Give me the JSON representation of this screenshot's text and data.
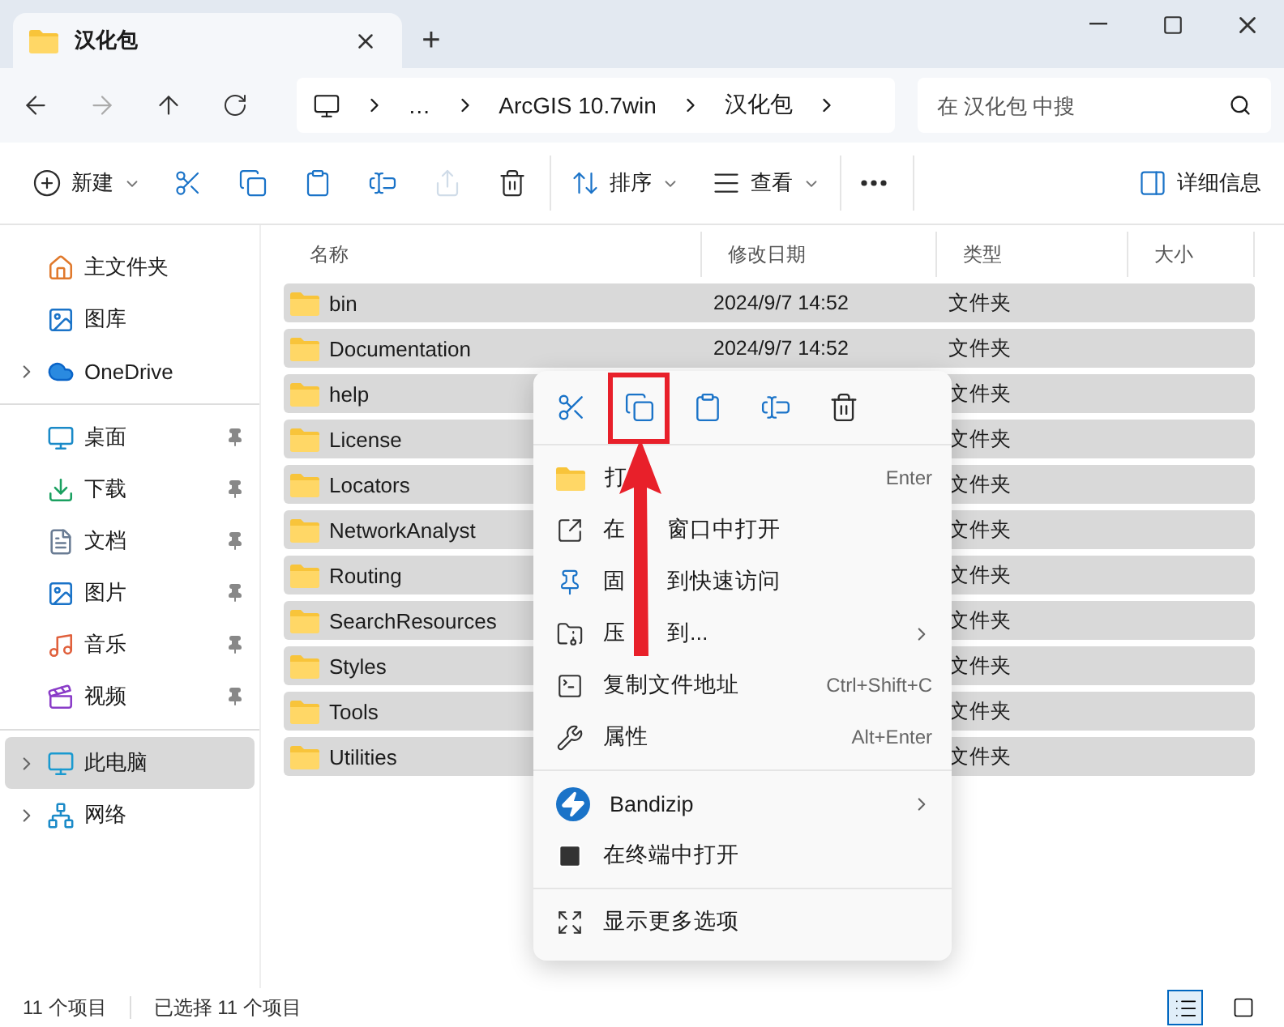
{
  "window": {
    "tab_title": "汉化包",
    "new_tab": "+"
  },
  "navigation": {
    "path": [
      "…",
      "ArcGIS 10.7win",
      "汉化包"
    ],
    "search": {
      "placeholder": "在 汉化包 中搜"
    }
  },
  "toolbar": {
    "groups": [
      [
        {
          "kind": "new",
          "label": "新建",
          "dropdown": true,
          "disabled": false
        },
        {
          "kind": "cut",
          "disabled": false
        },
        {
          "kind": "copy",
          "disabled": false
        },
        {
          "kind": "paste",
          "disabled": false
        },
        {
          "kind": "rename",
          "disabled": false
        },
        {
          "kind": "share",
          "disabled": true
        },
        {
          "kind": "delete",
          "disabled": false
        }
      ],
      [
        {
          "kind": "sort",
          "label": "排序",
          "dropdown": true,
          "disabled": false
        },
        {
          "kind": "view",
          "label": "查看",
          "dropdown": true,
          "disabled": false
        }
      ],
      [
        {
          "kind": "more",
          "disabled": false
        }
      ]
    ],
    "details": "详细信息"
  },
  "sidebar": {
    "groups": [
      [
        {
          "kind": "home",
          "label": "主文件夹",
          "expandable": false,
          "pinned": false,
          "selected": false
        },
        {
          "kind": "gallery",
          "label": "图库",
          "expandable": false,
          "pinned": false,
          "selected": false
        },
        {
          "kind": "cloud",
          "label": "OneDrive",
          "expandable": true,
          "pinned": false,
          "selected": false
        }
      ],
      [
        {
          "kind": "desktop",
          "label": "桌面",
          "expandable": false,
          "pinned": true,
          "selected": false
        },
        {
          "kind": "download",
          "label": "下载",
          "expandable": false,
          "pinned": true,
          "selected": false
        },
        {
          "kind": "document",
          "label": "文档",
          "expandable": false,
          "pinned": true,
          "selected": false
        },
        {
          "kind": "picture",
          "label": "图片",
          "expandable": false,
          "pinned": true,
          "selected": false
        },
        {
          "kind": "music",
          "label": "音乐",
          "expandable": false,
          "pinned": true,
          "selected": false
        },
        {
          "kind": "video",
          "label": "视频",
          "expandable": false,
          "pinned": true,
          "selected": false
        }
      ],
      [
        {
          "kind": "pc",
          "label": "此电脑",
          "expandable": true,
          "pinned": false,
          "selected": true
        },
        {
          "kind": "network",
          "label": "网络",
          "expandable": true,
          "pinned": false,
          "selected": false
        }
      ]
    ]
  },
  "table": {
    "columns": [
      "名称",
      "修改日期",
      "类型",
      "大小"
    ],
    "rows": [
      {
        "name": "bin",
        "modified": "2024/9/7 14:52",
        "type": "文件夹",
        "selected": true
      },
      {
        "name": "Documentation",
        "modified": "2024/9/7 14:52",
        "type": "文件夹",
        "selected": true
      },
      {
        "name": "help",
        "type": "文件夹",
        "selected": true
      },
      {
        "name": "License",
        "type": "文件夹",
        "selected": true
      },
      {
        "name": "Locators",
        "type": "文件夹",
        "selected": true
      },
      {
        "name": "NetworkAnalyst",
        "type": "文件夹",
        "selected": true
      },
      {
        "name": "Routing",
        "type": "文件夹",
        "selected": true
      },
      {
        "name": "SearchResources",
        "type": "文件夹",
        "selected": true
      },
      {
        "name": "Styles",
        "type": "文件夹",
        "selected": true
      },
      {
        "name": "Tools",
        "type": "文件夹",
        "selected": true
      },
      {
        "name": "Utilities",
        "type": "文件夹",
        "selected": true
      }
    ]
  },
  "context_menu": {
    "actions": [
      {
        "kind": "cut",
        "highlighted": false
      },
      {
        "kind": "copy",
        "highlighted": true
      },
      {
        "kind": "paste",
        "highlighted": false
      },
      {
        "kind": "rename",
        "highlighted": false
      },
      {
        "kind": "delete",
        "highlighted": false
      }
    ],
    "groups": [
      [
        {
          "kind": "open",
          "label": "打",
          "shortcut": "Enter",
          "submenu": false
        },
        {
          "kind": "new-window",
          "label": "在",
          "label_after": "窗口中打开",
          "submenu": false
        },
        {
          "kind": "pin",
          "label": "固",
          "label_after": "到快速访问",
          "submenu": false
        },
        {
          "kind": "compress",
          "label": "压",
          "label_after": "到...",
          "submenu": true
        },
        {
          "kind": "copy-path",
          "label": "复制文件地址",
          "shortcut": "Ctrl+Shift+C",
          "submenu": false
        },
        {
          "kind": "properties",
          "label": "属性",
          "shortcut": "Alt+Enter",
          "submenu": false
        }
      ],
      [
        {
          "kind": "bandizip",
          "label": "Bandizip",
          "submenu": true
        },
        {
          "kind": "terminal",
          "label": "在终端中打开",
          "submenu": false
        }
      ],
      [
        {
          "kind": "more",
          "label": "显示更多选项",
          "submenu": false
        }
      ]
    ]
  },
  "status_bar": {
    "count": "11 个项目",
    "selection": "已选择 11 个项目",
    "views": [
      {
        "kind": "details",
        "selected": true
      },
      {
        "kind": "tiles",
        "selected": false
      }
    ]
  }
}
